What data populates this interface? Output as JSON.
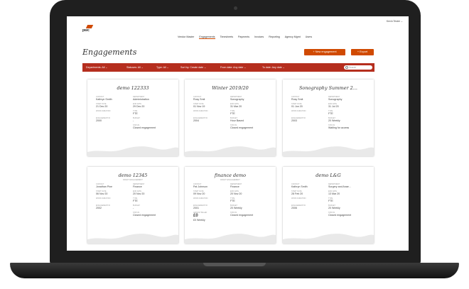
{
  "header": {
    "user": "Kevin Tester ⌄",
    "logo": "pwc",
    "nav": [
      "Vendor Master",
      "Engagements",
      "Timesheets",
      "Payments",
      "Invoices",
      "Reporting",
      "Agency Mgmt",
      "Users"
    ],
    "active_nav": 1
  },
  "page": {
    "title": "Engagements",
    "new_button": "+ New engagement",
    "export_button": "+ Export"
  },
  "filters": [
    "Departments: All ⌄",
    "Statuses: All ⌄",
    "Type: All ⌄",
    "Sort by: Create date ⌄",
    "From date: Any date ⌄",
    "To date: Any date ⌄"
  ],
  "search": {
    "placeholder": "Search"
  },
  "cards": [
    {
      "title": "demo 122333",
      "subtitle": "",
      "fields": [
        {
          "label": "CONTACT",
          "value": "Kathryn Smith"
        },
        {
          "label": "DEPARTMENT",
          "value": "Administration"
        },
        {
          "label": "START DATE",
          "value": "21 Dec 20"
        },
        {
          "label": "END DATE",
          "value": "29 Dec 20"
        },
        {
          "label": "WORK DURATION",
          "value": ""
        },
        {
          "label": "TYPE",
          "value": "FTE"
        },
        {
          "label": "ENGAGEMENT ID",
          "value": "2000"
        },
        {
          "label": "BUDGET",
          "value": "-"
        },
        {
          "label": "",
          "value": ""
        },
        {
          "label": "STATUS",
          "value": "Closed engagement"
        }
      ]
    },
    {
      "title": "Winter 2019/20",
      "subtitle": "",
      "fields": [
        {
          "label": "CONTACT",
          "value": "Rosy Smit"
        },
        {
          "label": "DEPARTMENT",
          "value": "Sonography"
        },
        {
          "label": "START DATE",
          "value": "01 Nov 19"
        },
        {
          "label": "END DATE",
          "value": "31 Mar 20"
        },
        {
          "label": "WORK DURATION",
          "value": ""
        },
        {
          "label": "TYPE",
          "value": "FTE"
        },
        {
          "label": "ENGAGEMENT ID",
          "value": "2004"
        },
        {
          "label": "BUDGET",
          "value": "Hour Based"
        },
        {
          "label": "",
          "value": ""
        },
        {
          "label": "STATUS",
          "value": "Closed engagement"
        }
      ]
    },
    {
      "title": "Sonography Summer 2...",
      "subtitle": "",
      "fields": [
        {
          "label": "CONTACT",
          "value": "Rosy Smit"
        },
        {
          "label": "DEPARTMENT",
          "value": "Sonography"
        },
        {
          "label": "START DATE",
          "value": "01 Jun 20"
        },
        {
          "label": "END DATE",
          "value": "31 Jul 20"
        },
        {
          "label": "WORK DURATION",
          "value": ""
        },
        {
          "label": "TYPE",
          "value": "FTE"
        },
        {
          "label": "ENGAGEMENT ID",
          "value": "2003"
        },
        {
          "label": "BUDGET",
          "value": "20 Weekly"
        },
        {
          "label": "",
          "value": ""
        },
        {
          "label": "STATUS",
          "value": "Waiting for access"
        }
      ]
    },
    {
      "title": "demo 12345",
      "subtitle": "DRAFT ENGAGEMENT",
      "fields": [
        {
          "label": "CONTACT",
          "value": "Jonathan Pine"
        },
        {
          "label": "DEPARTMENT",
          "value": "Finance"
        },
        {
          "label": "START DATE",
          "value": "06 Nov 20"
        },
        {
          "label": "END DATE",
          "value": "20 Nov 20"
        },
        {
          "label": "WORK DURATION",
          "value": ""
        },
        {
          "label": "TYPE",
          "value": "FTE"
        },
        {
          "label": "ENGAGEMENT ID",
          "value": "2002"
        },
        {
          "label": "BUDGET",
          "value": "-"
        },
        {
          "label": "",
          "value": ""
        },
        {
          "label": "STATUS",
          "value": "Closed engagement"
        }
      ]
    },
    {
      "title": "finance demo",
      "subtitle": "DRAFT ENGAGEMENT",
      "fields": [
        {
          "label": "CONTACT",
          "value": "Pat Johnson"
        },
        {
          "label": "DEPARTMENT",
          "value": "Finance"
        },
        {
          "label": "START DATE",
          "value": "09 Nov 20"
        },
        {
          "label": "END DATE",
          "value": "20 Nov 20"
        },
        {
          "label": "WORK DURATION",
          "value": ""
        },
        {
          "label": "TYPE",
          "value": "FTE"
        },
        {
          "label": "ENGAGEMENT ID",
          "value": "2001"
        },
        {
          "label": "BUDGET",
          "value": "20 Weekly"
        },
        {
          "label": "AMOUNT BILLED",
          "value": "£0",
          "big": true
        },
        {
          "label": "STATUS",
          "value": "Closed engagement"
        },
        {
          "label": "",
          "value": "£0 Weekly"
        }
      ]
    },
    {
      "title": "demo L&G",
      "subtitle": "",
      "fields": [
        {
          "label": "CONTACT",
          "value": "Kathryn Smith"
        },
        {
          "label": "DEPARTMENT",
          "value": "Surgery and Anae..."
        },
        {
          "label": "START DATE",
          "value": "28 Feb 20"
        },
        {
          "label": "END DATE",
          "value": "13 Mar 20"
        },
        {
          "label": "WORK DURATION",
          "value": ""
        },
        {
          "label": "TYPE",
          "value": "FTE"
        },
        {
          "label": "ENGAGEMENT ID",
          "value": "2006"
        },
        {
          "label": "BUDGET",
          "value": "20 Weekly"
        },
        {
          "label": "",
          "value": ""
        },
        {
          "label": "STATUS",
          "value": "Closed engagement"
        }
      ]
    }
  ]
}
